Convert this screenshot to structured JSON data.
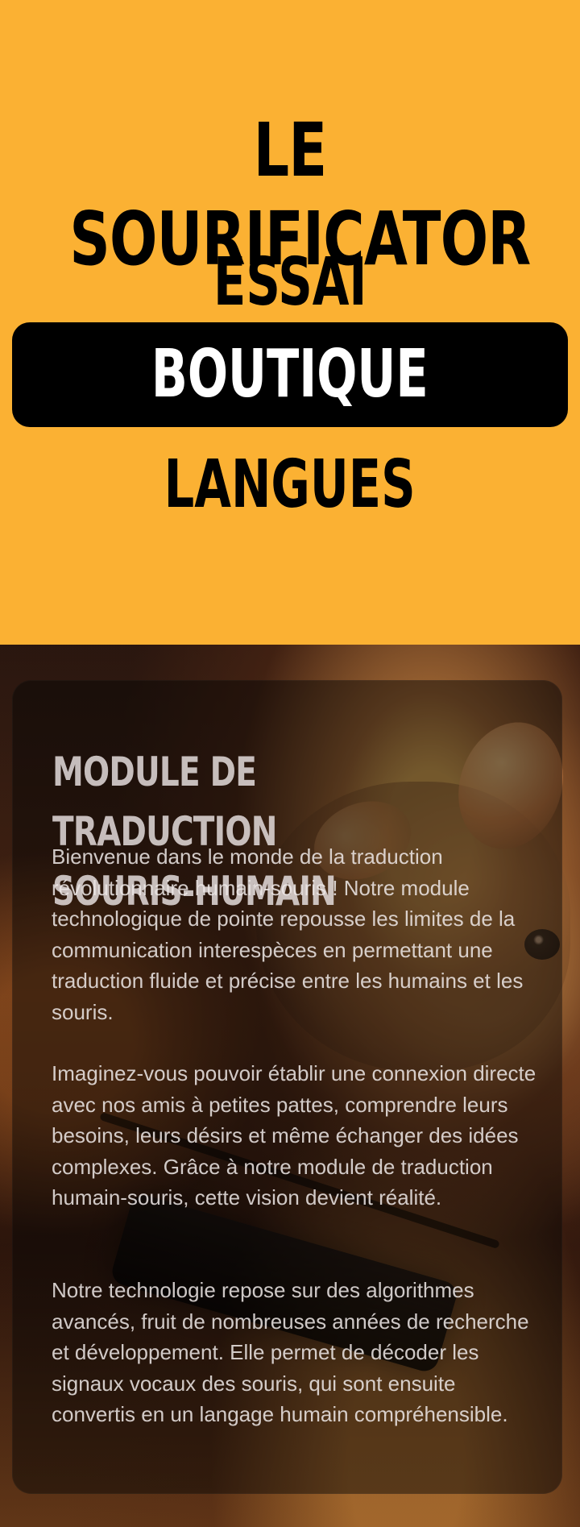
{
  "header": {
    "site_title": "LE SOURIFICATOR"
  },
  "navigation": {
    "items": [
      {
        "label": "ESSAI"
      },
      {
        "label": "BOUTIQUE"
      },
      {
        "label": "LANGUES"
      }
    ],
    "active_item": "BOUTIQUE"
  },
  "hero": {
    "title": "MODULE DE TRADUCTION\nSOURIS-HUMAIN",
    "paragraphs": [
      "Bienvenue dans le monde de la traduction révolutionnaire humain-souris ! Notre module technologique de pointe repousse les limites de la communication interespèces en permettant une traduction fluide et précise entre les humains et les souris.",
      "Imaginez-vous pouvoir établir une connexion directe avec nos amis à petites pattes, comprendre leurs besoins, leurs désirs et même échanger des idées complexes. Grâce à notre module de traduction humain-souris, cette vision devient réalité.",
      "Notre technologie repose sur des algorithmes avancés, fruit de nombreuses années de recherche et développement. Elle permet de décoder les signaux vocaux des souris, qui sont ensuite convertis en un langage humain compréhensible."
    ]
  },
  "colors": {
    "header_background": "#fbb133",
    "active_nav_background": "#000000",
    "active_nav_text": "#ffffff",
    "panel_text": "#eee8e7"
  }
}
